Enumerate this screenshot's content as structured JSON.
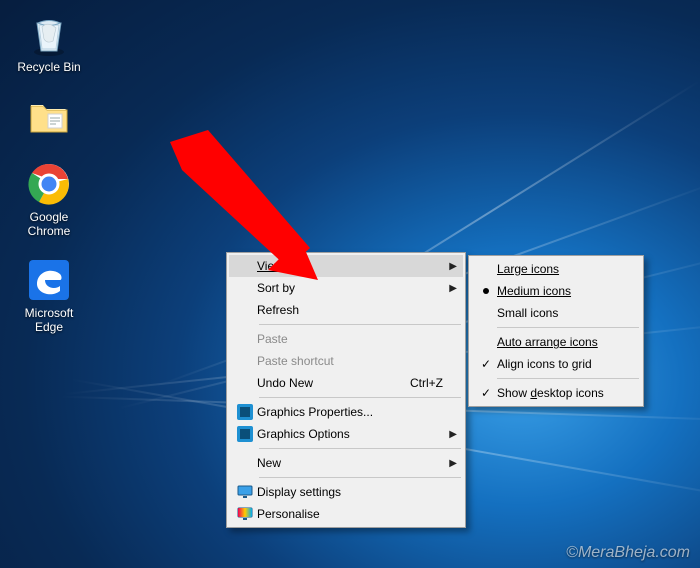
{
  "desktop": {
    "icons": [
      {
        "name": "recycle-bin",
        "label": "Recycle Bin"
      },
      {
        "name": "folder",
        "label": ""
      },
      {
        "name": "google-chrome",
        "label": "Google Chrome"
      },
      {
        "name": "microsoft-edge",
        "label": "Microsoft Edge"
      }
    ]
  },
  "context_menu": {
    "view": {
      "label": "View",
      "has_submenu": true,
      "highlighted": true
    },
    "sort_by": {
      "label": "Sort by",
      "has_submenu": true
    },
    "refresh": {
      "label": "Refresh"
    },
    "paste": {
      "label": "Paste",
      "disabled": true
    },
    "paste_shortcut": {
      "label": "Paste shortcut",
      "disabled": true
    },
    "undo": {
      "label": "Undo New",
      "shortcut": "Ctrl+Z"
    },
    "graphics_properties": {
      "label": "Graphics Properties..."
    },
    "graphics_options": {
      "label": "Graphics Options",
      "has_submenu": true
    },
    "new": {
      "label": "New",
      "has_submenu": true
    },
    "display_settings": {
      "label": "Display settings"
    },
    "personalise": {
      "label": "Personalise"
    }
  },
  "view_submenu": {
    "large_icons": {
      "label": "Large icons"
    },
    "medium_icons": {
      "label": "Medium icons",
      "selected": true
    },
    "small_icons": {
      "label": "Small icons"
    },
    "auto_arrange": {
      "label": "Auto arrange icons"
    },
    "align_to_grid": {
      "label": "Align icons to grid",
      "checked": true
    },
    "show_icons": {
      "label": "Show desktop icons",
      "checked": true
    }
  },
  "watermark": "©MeraBheja.com"
}
